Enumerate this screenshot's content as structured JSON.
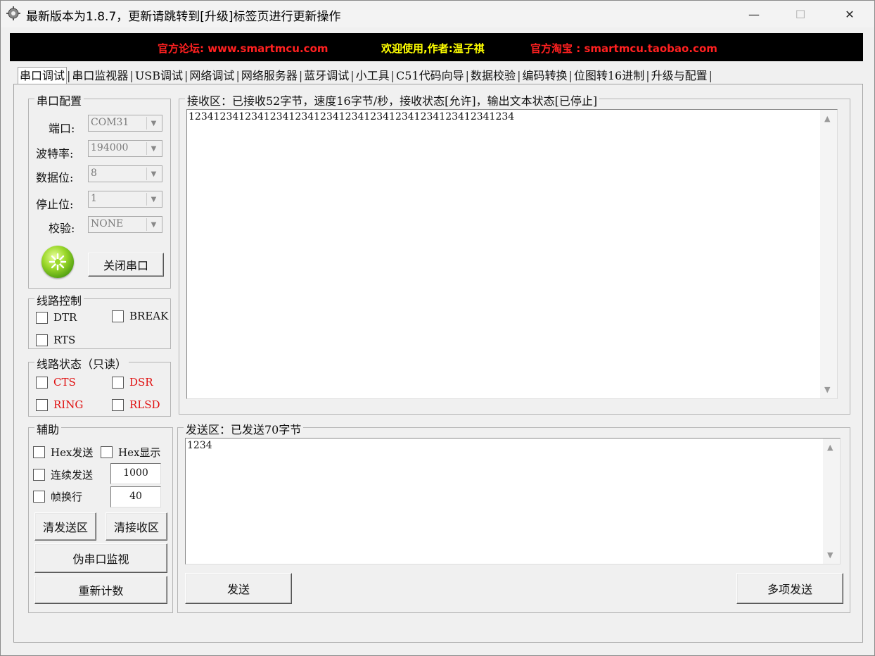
{
  "window": {
    "title": "最新版本为1.8.7，更新请跳转到[升级]标签页进行更新操作",
    "min_glyph": "—",
    "max_glyph": "☐",
    "close_glyph": "✕"
  },
  "banner": {
    "forum": "官方论坛: www.smartmcu.com",
    "welcome": "欢迎使用,作者:温子祺",
    "taobao": "官方淘宝 : smartmcu.taobao.com",
    "colors": {
      "red": "#ff2020",
      "yellow": "#ffff00"
    }
  },
  "tabs": [
    "串口调试",
    "串口监视器",
    "USB调试",
    "网络调试",
    "网络服务器",
    "蓝牙调试",
    "小工具",
    "C51代码向导",
    "数据校验",
    "编码转换",
    "位图转16进制",
    "升级与配置"
  ],
  "serial_config": {
    "title": "串口配置",
    "port_label": "端口:",
    "port_value": "COM31",
    "baud_label": "波特率:",
    "baud_value": "194000",
    "databits_label": "数据位:",
    "databits_value": "8",
    "stopbits_label": "停止位:",
    "stopbits_value": "1",
    "parity_label": "校验:",
    "parity_value": "NONE",
    "close_button": "关闭串口"
  },
  "line_control": {
    "title": "线路控制",
    "dtr": "DTR",
    "break": "BREAK",
    "rts": "RTS"
  },
  "line_status": {
    "title": "线路状态（只读）",
    "cts": "CTS",
    "dsr": "DSR",
    "ring": "RING",
    "rlsd": "RLSD"
  },
  "aux": {
    "title": "辅助",
    "hex_send": "Hex发送",
    "hex_display": "Hex显示",
    "continuous_send": "连续发送",
    "continuous_value": "1000",
    "frame_newline": "帧换行",
    "frame_value": "40",
    "clear_send": "清发送区",
    "clear_recv": "清接收区",
    "fake_monitor": "伪串口监视",
    "recount": "重新计数"
  },
  "receive": {
    "title": "接收区：已接收52字节，速度16字节/秒，接收状态[允许]，输出文本状态[已停止]",
    "content": "1234123412341234123412341234123412341234123412341234"
  },
  "send": {
    "title": "发送区：已发送70字节",
    "content": "1234",
    "send_button": "发送",
    "multi_send_button": "多项发送"
  },
  "icons": {
    "scroll_up": "▲",
    "scroll_down": "▼",
    "combo_arrow": "▼"
  }
}
